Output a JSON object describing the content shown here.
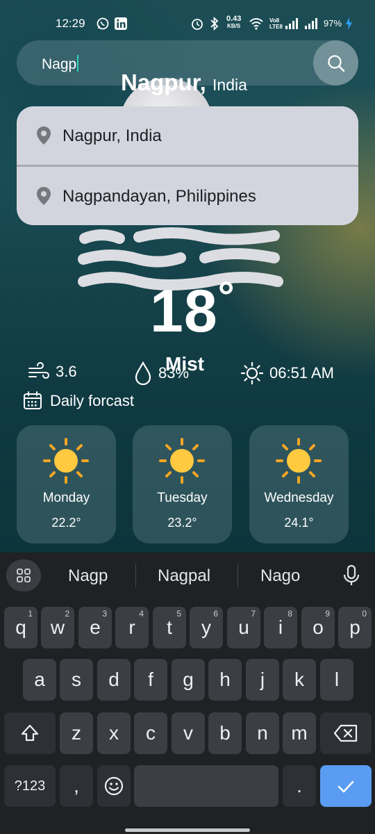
{
  "status_bar": {
    "time": "12:29",
    "network_speed_value": "0.43",
    "network_speed_unit": "KB/S",
    "volte_label": "Vo8",
    "lte_label": "LTE8",
    "battery": "97%"
  },
  "search": {
    "query": "Nagp"
  },
  "location": {
    "city": "Nagpur,",
    "country": "India"
  },
  "suggestions_dropdown": [
    {
      "label": "Nagpur, India"
    },
    {
      "label": "Nagpandayan, Philippines"
    }
  ],
  "weather": {
    "temperature": "18",
    "degree_symbol": "°",
    "condition": "Mist",
    "wind_speed": "3.6",
    "humidity": "83%",
    "sunrise": "06:51 AM"
  },
  "daily": {
    "label": "Daily forcast",
    "days": [
      {
        "day": "Monday",
        "temp": "22.2°",
        "icon": "sun-icon"
      },
      {
        "day": "Tuesday",
        "temp": "23.2°",
        "icon": "sun-icon"
      },
      {
        "day": "Wednesday",
        "temp": "24.1°",
        "icon": "sun-icon"
      }
    ]
  },
  "keyboard": {
    "suggestions": [
      "Nagp",
      "Nagpal",
      "Nago"
    ],
    "row1": [
      {
        "key": "q",
        "hint": "1"
      },
      {
        "key": "w",
        "hint": "2"
      },
      {
        "key": "e",
        "hint": "3"
      },
      {
        "key": "r",
        "hint": "4"
      },
      {
        "key": "t",
        "hint": "5"
      },
      {
        "key": "y",
        "hint": "6"
      },
      {
        "key": "u",
        "hint": "7"
      },
      {
        "key": "i",
        "hint": "8"
      },
      {
        "key": "o",
        "hint": "9"
      },
      {
        "key": "p",
        "hint": "0"
      }
    ],
    "row2": [
      "a",
      "s",
      "d",
      "f",
      "g",
      "h",
      "j",
      "k",
      "l"
    ],
    "row3": [
      "z",
      "x",
      "c",
      "v",
      "b",
      "n",
      "m"
    ],
    "symbols_label": "?123",
    "comma": ",",
    "period": "."
  },
  "colors": {
    "accent_cursor": "#2bd5b5",
    "enter_key": "#5a9cf2",
    "sun_yellow": "#ffc940",
    "sun_rays": "#f5a623"
  }
}
